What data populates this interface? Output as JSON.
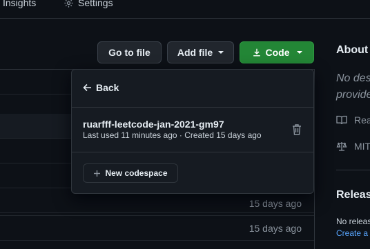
{
  "topnav": {
    "insights_label": "Insights",
    "settings_label": "Settings"
  },
  "toolbar": {
    "goto_file_label": "Go to file",
    "add_file_label": "Add file",
    "code_label": "Code"
  },
  "filelist": {
    "rows": [
      {
        "age": ""
      },
      {
        "age": ""
      },
      {
        "age": ""
      },
      {
        "age": ""
      },
      {
        "age": ""
      },
      {
        "age": "15 days ago"
      },
      {
        "age": "15 days ago"
      }
    ]
  },
  "sidebar": {
    "about_title": "About",
    "about_desc_line1": "No des",
    "about_desc_line2": "provide",
    "readme_label": "Rea",
    "license_label": "MIT",
    "releases_title": "Releas",
    "no_releases_text": "No releas",
    "create_link": "Create a"
  },
  "dropdown": {
    "back_label": "Back",
    "codespace_name": "ruarfff-leetcode-jan-2021-gm97",
    "codespace_meta": "Last used 11 minutes ago · Created 15 days ago",
    "new_codespace_label": "New codespace"
  },
  "colors": {
    "code_button": "#238636",
    "link": "#58a6ff",
    "background": "#0d1117",
    "panel": "#161b22"
  }
}
